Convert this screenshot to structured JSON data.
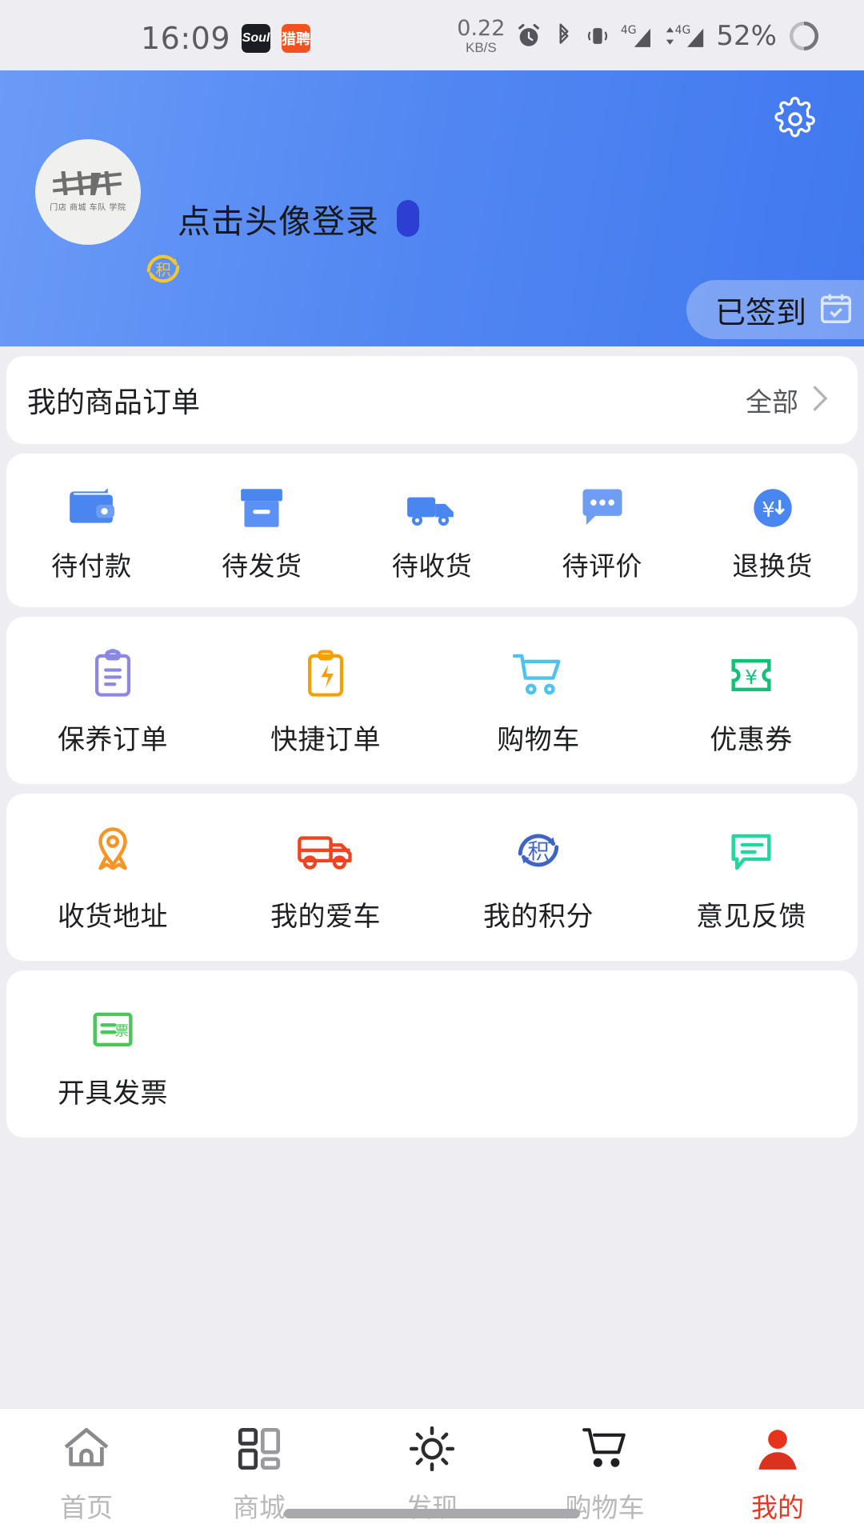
{
  "status_bar": {
    "time": "16:09",
    "app_icons": [
      {
        "name": "soul-app-icon",
        "label": "Soul"
      },
      {
        "name": "liepin-app-icon",
        "label": "猎聘"
      }
    ],
    "net_speed_value": "0.22",
    "net_speed_unit": "KB/S",
    "icons": [
      "alarm-icon",
      "bluetooth-icon",
      "vibrate-icon",
      "signal-4g-icon",
      "signal-4g-data-icon"
    ],
    "network_label": "4G",
    "battery_percent": "52%"
  },
  "header": {
    "settings_icon": "gear-icon",
    "avatar": {
      "logo_sub_text": "门店 商城 车队 学院"
    },
    "login_text": "点击头像登录",
    "points_badge_text": "积",
    "signin": {
      "label": "已签到",
      "icon": "calendar-check-icon"
    },
    "gradient_from": "#6b9bf7",
    "gradient_to": "#4078ef"
  },
  "orders": {
    "title": "我的商品订单",
    "all_label": "全部",
    "chevron_icon": "chevron-right-icon",
    "statuses": [
      {
        "label": "待付款",
        "icon": "wallet-icon",
        "color": "#4a86f0"
      },
      {
        "label": "待发货",
        "icon": "box-icon",
        "color": "#4a86f0"
      },
      {
        "label": "待收货",
        "icon": "truck-icon",
        "color": "#4a86f0"
      },
      {
        "label": "待评价",
        "icon": "comment-icon",
        "color": "#6f9df4"
      },
      {
        "label": "退换货",
        "icon": "refund-yuan-icon",
        "color": "#4a86f0"
      }
    ]
  },
  "services": {
    "row1": [
      {
        "label": "保养订单",
        "icon": "clipboard-icon",
        "color": "#8b87e3"
      },
      {
        "label": "快捷订单",
        "icon": "clipboard-bolt-icon",
        "color": "#f5a000"
      },
      {
        "label": "购物车",
        "icon": "cart-icon",
        "color": "#4ec3ef"
      },
      {
        "label": "优惠券",
        "icon": "coupon-icon",
        "color": "#13c07a"
      }
    ],
    "row2": [
      {
        "label": "收货地址",
        "icon": "location-pin-icon",
        "color": "#f79426"
      },
      {
        "label": "我的爱车",
        "icon": "truck-outline-icon",
        "color": "#ef4423"
      },
      {
        "label": "我的积分",
        "icon": "points-refresh-icon",
        "color": "#3f64c8"
      },
      {
        "label": "意见反馈",
        "icon": "feedback-icon",
        "color": "#23d6a0"
      }
    ],
    "row3": [
      {
        "label": "开具发票",
        "icon": "invoice-icon",
        "color": "#4cc65c"
      }
    ]
  },
  "tabbar": {
    "items": [
      {
        "label": "首页",
        "icon": "home-icon",
        "active": false
      },
      {
        "label": "商城",
        "icon": "grid-icon",
        "active": false
      },
      {
        "label": "发现",
        "icon": "discover-sun-icon",
        "active": false
      },
      {
        "label": "购物车",
        "icon": "cart-icon",
        "active": false
      },
      {
        "label": "我的",
        "icon": "profile-icon",
        "active": true
      }
    ],
    "active_color": "#e03a24",
    "inactive_color": "#b9b9bc"
  }
}
